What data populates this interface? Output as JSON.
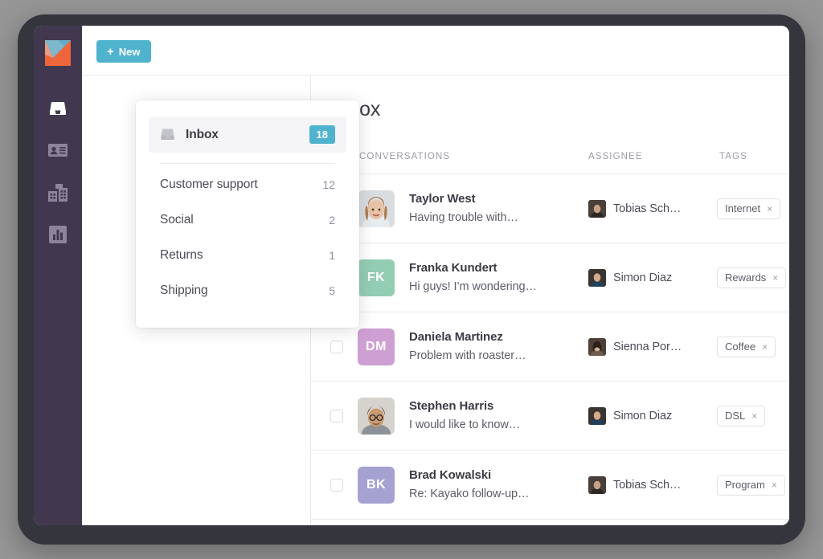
{
  "app": {
    "logo_icon": "kayako-logo-icon",
    "brand_colors": {
      "accent": "#4fb3ce",
      "sidebar": "#413850",
      "bezel": "#35353d",
      "backdrop": "#969696"
    }
  },
  "rail": {
    "items": [
      {
        "icon": "inbox-icon",
        "name": "rail-item-inbox",
        "active": true
      },
      {
        "icon": "contact-card-icon",
        "name": "rail-item-contacts",
        "active": false
      },
      {
        "icon": "organizations-icon",
        "name": "rail-item-organizations",
        "active": false
      },
      {
        "icon": "bar-chart-icon",
        "name": "rail-item-reports",
        "active": false
      }
    ]
  },
  "toolbar": {
    "new_label": "New",
    "new_plus": "+"
  },
  "panel": {
    "inbox": {
      "icon": "inbox-icon",
      "label": "Inbox",
      "count": "18"
    },
    "items": [
      {
        "label": "Customer support",
        "count": "12"
      },
      {
        "label": "Social",
        "count": "2"
      },
      {
        "label": "Returns",
        "count": "1"
      },
      {
        "label": "Shipping",
        "count": "5"
      }
    ]
  },
  "list": {
    "page_title": "Inbox",
    "columns": {
      "conversations": "CONVERSATIONS",
      "assignee": "ASSIGNEE",
      "tags": "TAGS"
    },
    "rows": [
      {
        "name": "Taylor West",
        "snippet": "Having trouble with…",
        "avatar_type": "photo",
        "avatar_initials": "",
        "avatar_color": "#cfd4d8",
        "assignee": "Tobias Sch…",
        "assignee_color": "#4a3f3a",
        "tag": "Internet",
        "tag_close": "×",
        "checkbox_visible": false
      },
      {
        "name": "Franka Kundert",
        "snippet": "Hi guys! I’m wondering…",
        "avatar_type": "initials",
        "avatar_initials": "FK",
        "avatar_color": "#93ceb4",
        "assignee": "Simon Diaz",
        "assignee_color": "#3a3430",
        "tag": "Rewards",
        "tag_close": "×",
        "checkbox_visible": false
      },
      {
        "name": "Daniela Martinez",
        "snippet": "Problem with roaster…",
        "avatar_type": "initials",
        "avatar_initials": "DM",
        "avatar_color": "#ce9fd2",
        "assignee": "Sienna Por…",
        "assignee_color": "#4e4038",
        "tag": "Coffee",
        "tag_close": "×",
        "checkbox_visible": true
      },
      {
        "name": "Stephen Harris",
        "snippet": "I would like to know…",
        "avatar_type": "photo",
        "avatar_initials": "",
        "avatar_color": "#c4c0bc",
        "assignee": "Simon Diaz",
        "assignee_color": "#3a3430",
        "tag": "DSL",
        "tag_close": "×",
        "checkbox_visible": true
      },
      {
        "name": "Brad Kowalski",
        "snippet": "Re: Kayako follow-up…",
        "avatar_type": "initials",
        "avatar_initials": "BK",
        "avatar_color": "#a5a2d2",
        "assignee": "Tobias Sch…",
        "assignee_color": "#4a3f3a",
        "tag": "Program",
        "tag_close": "×",
        "checkbox_visible": true
      }
    ]
  }
}
